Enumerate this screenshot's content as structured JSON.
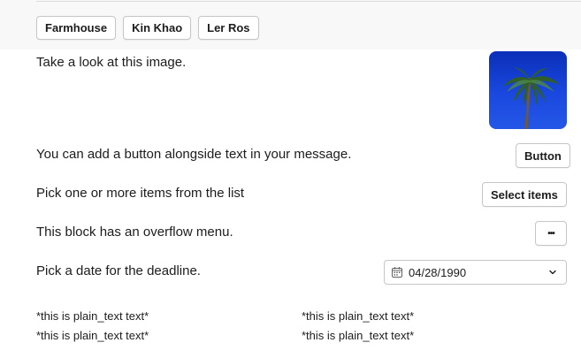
{
  "top_actions": [
    {
      "label": "Farmhouse"
    },
    {
      "label": "Kin Khao"
    },
    {
      "label": "Ler Ros"
    }
  ],
  "image_section": {
    "text": "Take a look at this image.",
    "image": {
      "icon": "palm-tree-image",
      "sky_color": "#1a48e0"
    }
  },
  "button_section": {
    "text": "You can add a button alongside text in your message.",
    "button_label": "Button"
  },
  "multiselect_section": {
    "text": "Pick one or more items from the list",
    "button_label": "Select items"
  },
  "overflow_section": {
    "text": "This block has an overflow menu.",
    "menu_label": "•••"
  },
  "date_section": {
    "text": "Pick a date for the deadline.",
    "date_value": "04/28/1990"
  },
  "fields": [
    "*this is plain_text text*",
    "*this is plain_text text*",
    "*this is plain_text text*",
    "*this is plain_text text*"
  ]
}
